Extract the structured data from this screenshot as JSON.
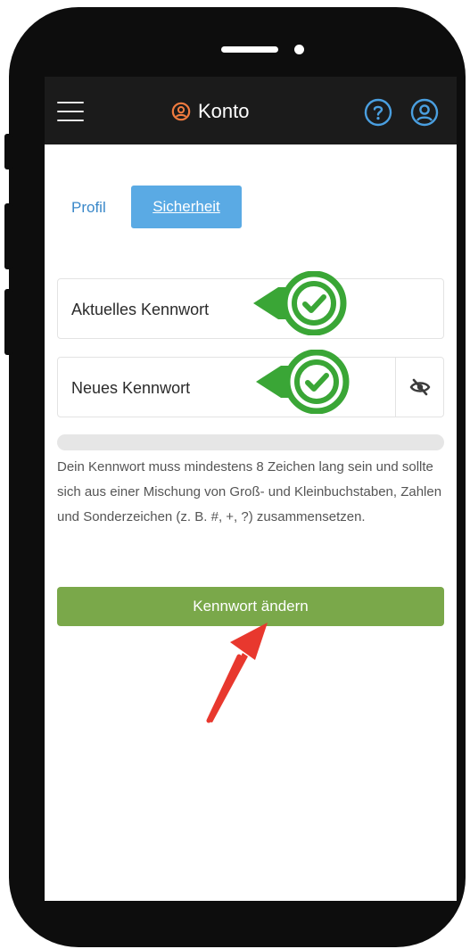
{
  "header": {
    "title": "Konto",
    "title_icon": "user-circle-icon",
    "menu_icon": "hamburger-menu-icon",
    "help_icon": "question-circle-icon",
    "account_icon": "user-circle-icon"
  },
  "tabs": [
    {
      "label": "Profil",
      "active": false
    },
    {
      "label": "Sicherheit",
      "active": true
    }
  ],
  "form": {
    "current_password_label": "Aktuelles Kennwort",
    "new_password_label": "Neues Kennwort",
    "visibility_icon": "eye-slash-icon",
    "hint": "Dein Kennwort muss mindestens 8 Zeichen lang sein und sollte sich aus einer Mischung von Groß- und Kleinbuchstaben, Zahlen und Sonderzeichen (z. B. #, +, ?) zusammensetzen.",
    "submit_label": "Kennwort ändern"
  },
  "colors": {
    "header_bg": "#1b1b1b",
    "accent_orange": "#f07b3f",
    "accent_blue": "#4a9fe0",
    "tab_active_bg": "#5aaae4",
    "submit_green": "#7aa84a",
    "check_green": "#3aa636",
    "arrow_red": "#e8382e"
  }
}
